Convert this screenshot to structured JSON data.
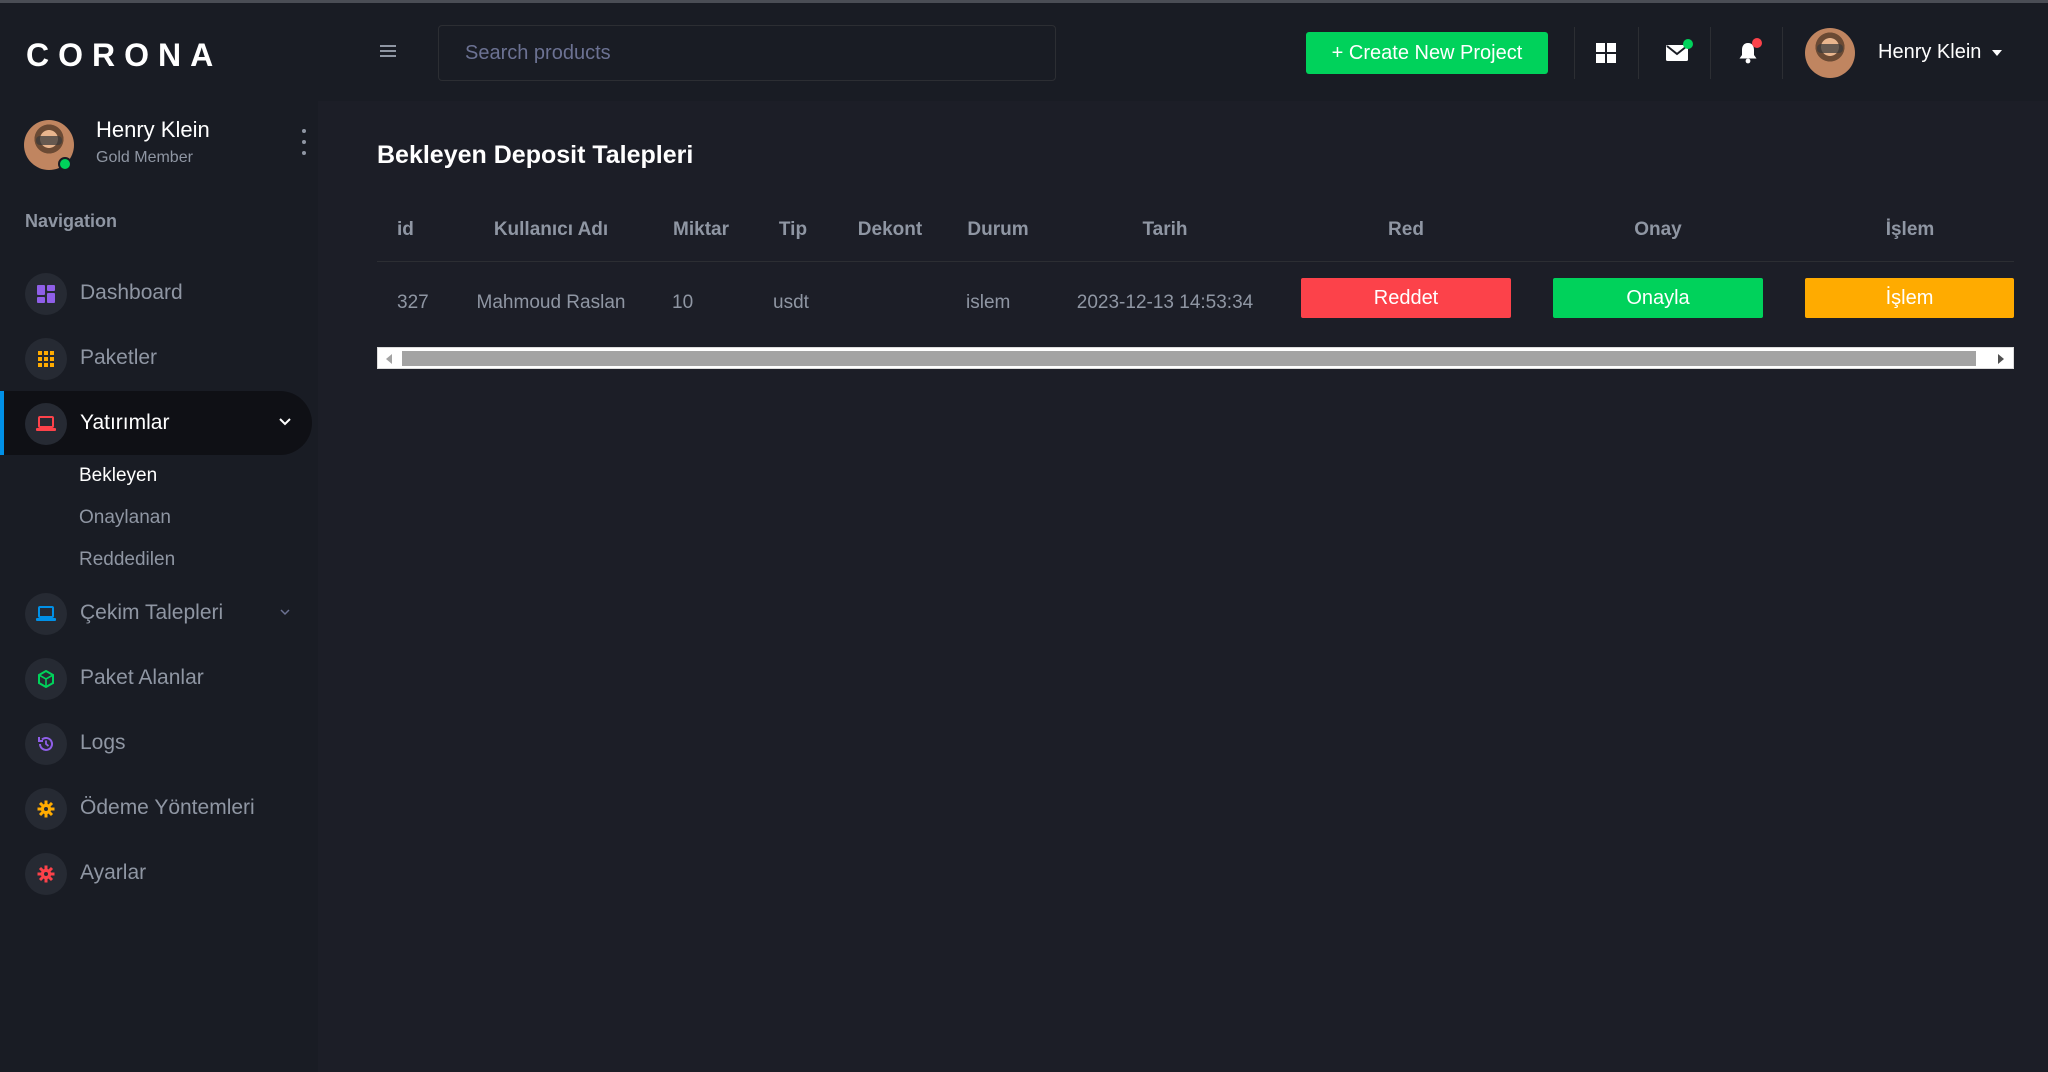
{
  "app": {
    "brand": "CORONA"
  },
  "sidebar": {
    "profile": {
      "name": "Henry Klein",
      "role": "Gold Member"
    },
    "nav_heading": "Navigation",
    "items": [
      {
        "label": "Dashboard",
        "icon": "dashboard-icon",
        "color": "#8f5fe8"
      },
      {
        "label": "Paketler",
        "icon": "grid-dots-icon",
        "color": "#ffab00"
      },
      {
        "label": "Yatırımlar",
        "icon": "laptop-icon",
        "color": "#fc424a",
        "active": true,
        "expanded": true
      },
      {
        "label": "Çekim Talepleri",
        "icon": "laptop-icon",
        "color": "#0090e7"
      },
      {
        "label": "Paket Alanlar",
        "icon": "cube-icon",
        "color": "#00d25b"
      },
      {
        "label": "Logs",
        "icon": "history-icon",
        "color": "#8f5fe8"
      },
      {
        "label": "Ödeme Yöntemleri",
        "icon": "gear-icon",
        "color": "#ffab00"
      },
      {
        "label": "Ayarlar",
        "icon": "gear-icon",
        "color": "#fc424a"
      }
    ],
    "subitems": [
      {
        "label": "Bekleyen",
        "active": true
      },
      {
        "label": "Onaylanan"
      },
      {
        "label": "Reddedilen"
      }
    ]
  },
  "navbar": {
    "search_placeholder": "Search products",
    "create_label": "+ Create New Project",
    "user_name": "Henry Klein"
  },
  "page": {
    "title": "Bekleyen Deposit Talepleri",
    "columns": [
      "id",
      "Kullanıcı Adı",
      "Miktar",
      "Tip",
      "Dekont",
      "Durum",
      "Tarih",
      "Red",
      "Onay",
      "İşlem"
    ],
    "rows": [
      {
        "id": "327",
        "username": "Mahmoud Raslan",
        "amount": "10",
        "type": "usdt",
        "receipt": "",
        "status": "islem",
        "date": "2023-12-13 14:53:34",
        "reject_label": "Reddet",
        "approve_label": "Onayla",
        "process_label": "İşlem"
      }
    ]
  },
  "colors": {
    "background": "#1c1e27",
    "sidebar": "#191c24",
    "success": "#00d25b",
    "danger": "#fc424a",
    "warning": "#ffab00",
    "primary": "#0090e7"
  }
}
